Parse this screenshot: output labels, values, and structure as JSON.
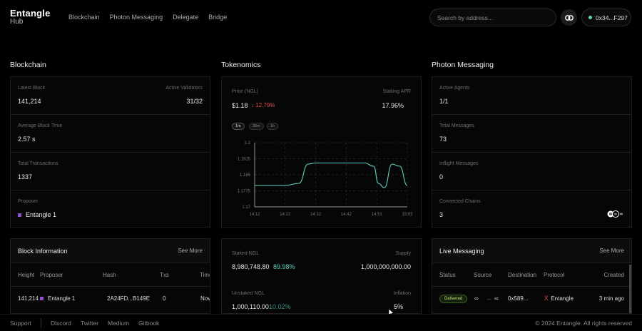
{
  "header": {
    "logo_line1": "Entangle",
    "logo_line2": "Hub",
    "nav": [
      "Blockchain",
      "Photon Messaging",
      "Delegate",
      "Bridge"
    ],
    "search_placeholder": "Search by address...",
    "wallet": "0x34...F297"
  },
  "blockchain": {
    "title": "Blockchain",
    "latest_block_label": "Latest Block",
    "latest_block": "141,214",
    "active_validators_label": "Active Validators",
    "active_validators": "31/32",
    "avg_block_time_label": "Average Block Time",
    "avg_block_time": "2.57 s",
    "total_tx_label": "Total Transactions",
    "total_tx": "1337",
    "proposer_label": "Proposer",
    "proposer": "Entangle 1"
  },
  "tokenomics": {
    "title": "Tokenomics",
    "price_label": "Price (NGL)",
    "price": "$1.18",
    "price_change": "12.79%",
    "staking_apr_label": "Staking APR",
    "staking_apr": "17.96%",
    "timeframes": [
      "1m",
      "30m",
      "1h"
    ],
    "staked_label": "Staked NGL",
    "staked": "8,980,748.80",
    "staked_pct": "89.98%",
    "supply_label": "Supply",
    "supply": "1,000,000,000.00",
    "unstaked_label": "Unstaked NGL",
    "unstaked": "1,000,110.00",
    "unstaked_pct": "10.02%",
    "inflation_label": "Inflation",
    "inflation": "5%"
  },
  "chart_data": {
    "type": "line",
    "x": [
      "14:12",
      "14:22",
      "14:32",
      "14:42",
      "14:51",
      "15:03"
    ],
    "yticks": [
      "1.2",
      "1.1925",
      "1.185",
      "1.1775",
      "1.17"
    ],
    "ylim": [
      1.17,
      1.2
    ],
    "series": [
      {
        "values_x": [
          0,
          0.6,
          1.0,
          1.45,
          1.75,
          2.0,
          3.0,
          3.6,
          3.9,
          4.05,
          4.25,
          4.5,
          4.75,
          5.0
        ],
        "values_y": [
          1.18,
          1.18,
          1.18,
          1.181,
          1.19,
          1.1905,
          1.1905,
          1.1905,
          1.189,
          1.181,
          1.179,
          1.19,
          1.189,
          1.18
        ]
      }
    ],
    "grid": true
  },
  "photon": {
    "title": "Photon Messaging",
    "active_agents_label": "Active Agents",
    "active_agents": "1/1",
    "total_messages_label": "Total Messages",
    "total_messages": "73",
    "inflight_label": "Inflight Messages",
    "inflight": "0",
    "connected_chains_label": "Connected Chains",
    "connected_chains": "3"
  },
  "block_info": {
    "title": "Block Information",
    "see_more": "See More",
    "columns": [
      "Height",
      "Proposer",
      "Hash",
      "Txs",
      "Time"
    ],
    "row": [
      "141,214",
      "Entangle 1",
      "2A24FD...B149E",
      "0",
      "Nov"
    ]
  },
  "live_messaging": {
    "title": "Live Messaging",
    "see_more": "See More",
    "columns": [
      "Status",
      "Source",
      "Destination",
      "Protocol",
      "Created"
    ],
    "row_status": "Delivered",
    "row_source": "∞",
    "row_arrow": "→",
    "row_dest_icon": "∞",
    "row_destination": "0x589...",
    "row_protocol": "Entangle",
    "row_created": "3 min ago"
  },
  "footer": {
    "support": "Support",
    "links": [
      "Discord",
      "Twitter",
      "Medium",
      "Gitbook"
    ],
    "copyright": "© 2024 Entangle. All rights reserved"
  },
  "colors": {
    "accent_teal": "#5fd3c4",
    "down_red": "#e0554f",
    "purple": "#8d4fd1"
  }
}
